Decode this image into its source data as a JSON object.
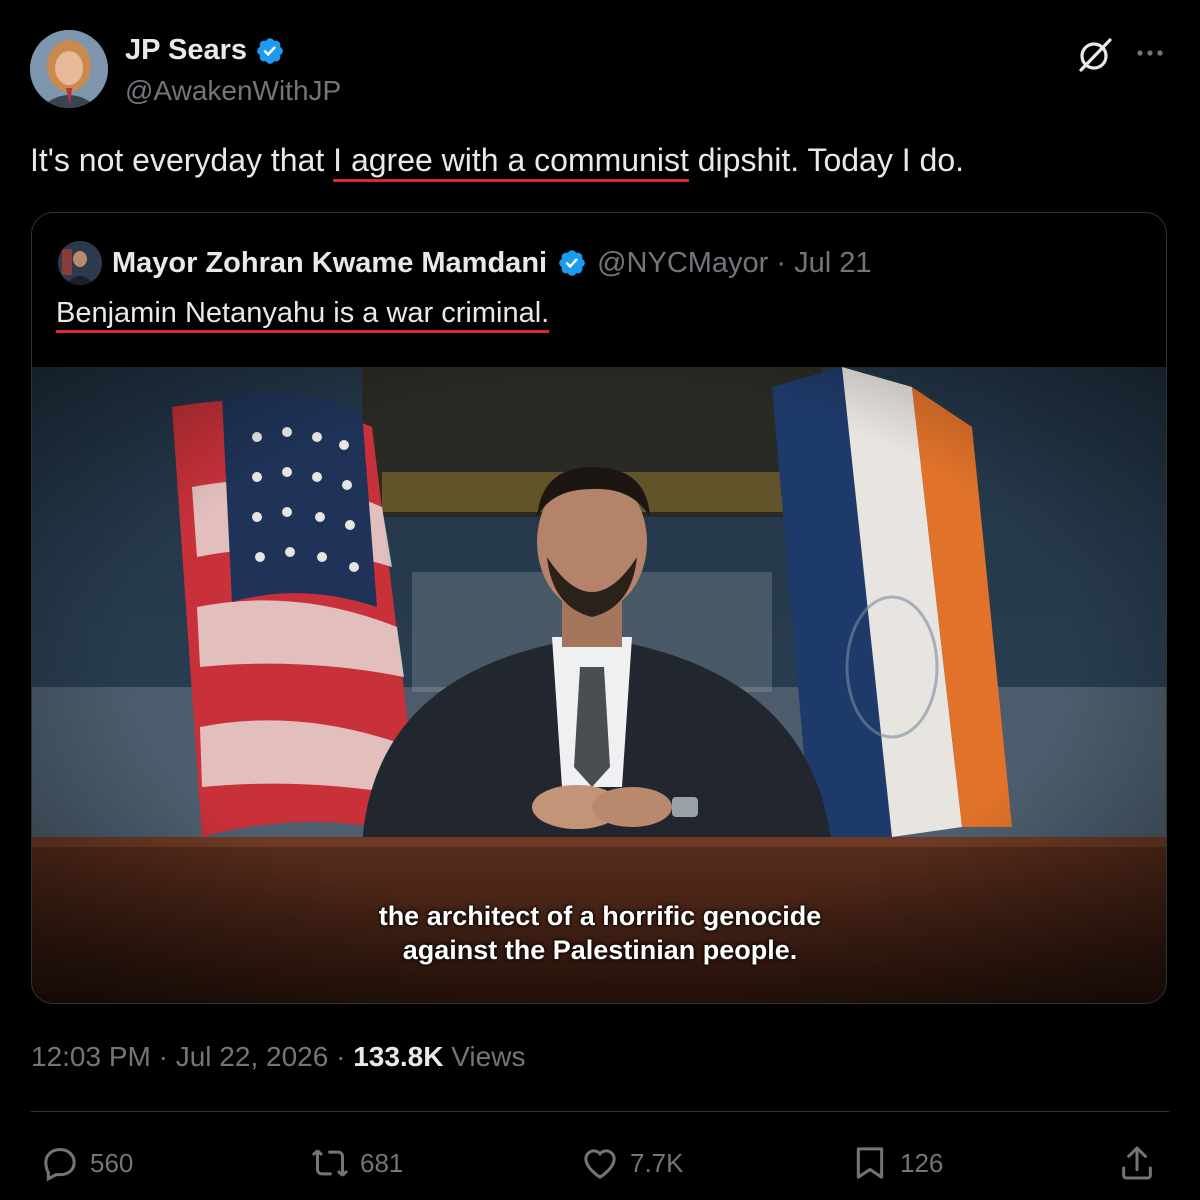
{
  "author": {
    "name": "JP Sears",
    "handle": "@AwakenWithJP"
  },
  "tweet": {
    "text_before": "It's not everyday that ",
    "text_highlight": "I agree with a communist",
    "text_after": " dipshit. Today I do."
  },
  "quoted": {
    "name": "Mayor Zohran Kwame Mamdani",
    "handle_date": "@NYCMayor · Jul 21",
    "text": "Benjamin Netanyahu is a war criminal.",
    "caption_line1": "the architect of a horrific genocide",
    "caption_line2": "against the Palestinian people."
  },
  "meta": {
    "time_date": "12:03 PM · Jul 22, 2026 · ",
    "views_count": "133.8K",
    "views_label": " Views"
  },
  "actions": {
    "replies": "560",
    "reposts": "681",
    "likes": "7.7K",
    "bookmarks": "126"
  },
  "colors": {
    "verified": "#1d9bf0",
    "underline": "#e0272a",
    "muted": "#71767b"
  },
  "icons": [
    "verified-badge-icon",
    "grok-icon",
    "more-icon",
    "reply-icon",
    "repost-icon",
    "like-icon",
    "bookmark-icon",
    "share-icon"
  ]
}
